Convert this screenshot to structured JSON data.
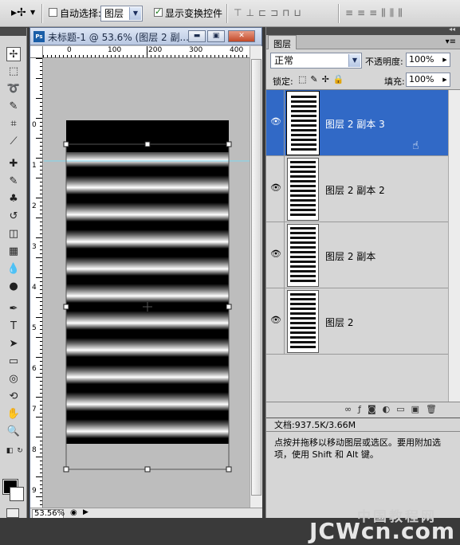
{
  "options": {
    "auto_select_label": "自动选择:",
    "auto_select_checked": false,
    "auto_select_value": "图层",
    "show_transform_label": "显示变换控件",
    "show_transform_checked": true
  },
  "document": {
    "title": "未标题-1 @ 53.6% (图层 2 副...",
    "zoom": "53.56%",
    "ruler_h": [
      "0",
      "100",
      "200",
      "300",
      "400"
    ],
    "ruler_v": [
      "0",
      "1",
      "2",
      "3",
      "4",
      "5",
      "6",
      "7",
      "8",
      "9"
    ]
  },
  "layers_panel": {
    "tab": "图层",
    "blend_mode": "正常",
    "opacity_label": "不透明度:",
    "opacity_value": "100%",
    "lock_label": "锁定:",
    "fill_label": "填充:",
    "fill_value": "100%",
    "layers": [
      {
        "name": "图层 2 副本 3",
        "selected": true,
        "visible": true
      },
      {
        "name": "图层 2 副本 2",
        "selected": false,
        "visible": true
      },
      {
        "name": "图层 2 副本",
        "selected": false,
        "visible": true
      },
      {
        "name": "图层 2",
        "selected": false,
        "visible": true
      }
    ]
  },
  "info": {
    "doc_size": "文档:937.5K/3.66M",
    "hint": "点按并拖移以移动图层或选区。要用附加选项，使用 Shift 和 Alt 键。"
  },
  "watermark": {
    "line1": "中国教程网",
    "line2": "JCWcn.com"
  }
}
